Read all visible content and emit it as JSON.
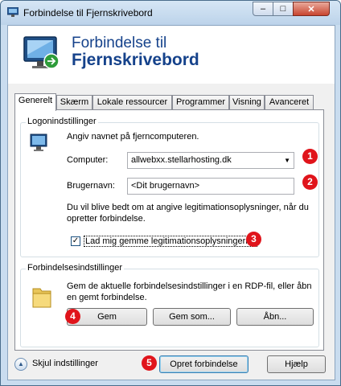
{
  "window": {
    "title": "Forbindelse til Fjernskrivebord",
    "min_glyph": "–",
    "max_glyph": "□",
    "close_glyph": "✕"
  },
  "header": {
    "line1": "Forbindelse til",
    "line2": "Fjernskrivebord"
  },
  "tabs": [
    {
      "label": "Generelt",
      "active": true
    },
    {
      "label": "Skærm",
      "active": false
    },
    {
      "label": "Lokale ressourcer",
      "active": false
    },
    {
      "label": "Programmer",
      "active": false
    },
    {
      "label": "Visning",
      "active": false
    },
    {
      "label": "Avanceret",
      "active": false
    }
  ],
  "logon": {
    "group_title": "Logonindstillinger",
    "description": "Angiv navnet på fjerncomputeren.",
    "computer_label": "Computer:",
    "computer_value": "allwebxx.stellarhosting.dk",
    "username_label": "Brugernavn:",
    "username_value": "<Dit brugernavn>",
    "credentials_note_line1": "Du vil blive bedt om at angive legitimationsoplysninger, når du",
    "credentials_note_line2": "opretter forbindelse.",
    "save_checkbox_label": "Lad mig gemme legitimationsoplysningerne",
    "save_checked": true
  },
  "connection_settings": {
    "group_title": "Forbindelsesindstillinger",
    "description_line1": "Gem de aktuelle forbindelsesindstillinger i en RDP-fil, eller åbn",
    "description_line2": "en gemt forbindelse.",
    "save_button": "Gem",
    "save_as_button": "Gem som...",
    "open_button": "Åbn..."
  },
  "footer": {
    "toggle_label": "Skjul indstillinger",
    "connect_button": "Opret forbindelse",
    "help_button": "Hjælp"
  },
  "annotations": [
    "1",
    "2",
    "3",
    "4",
    "5"
  ],
  "colors": {
    "title_text": "#15428b",
    "badge": "#e0141b",
    "window_frame": "#c9dcef"
  }
}
